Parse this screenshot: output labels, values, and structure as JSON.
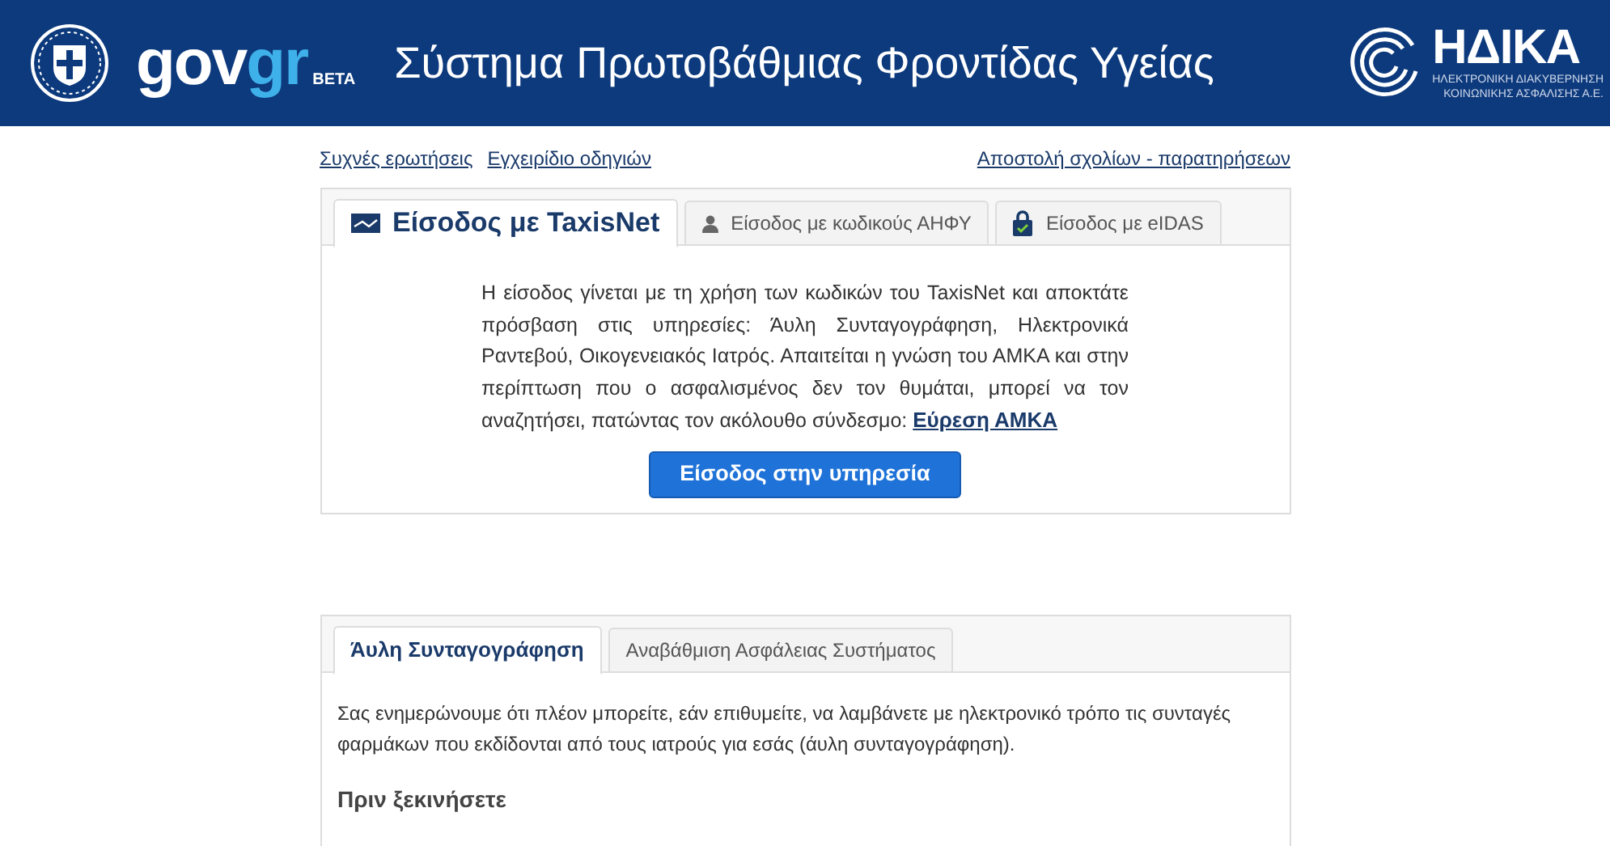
{
  "header": {
    "logo": {
      "part_1": "gov",
      "part_2": "gr",
      "badge": "BETA"
    },
    "title": "Σύστημα Πρωτοβάθμιας Φροντίδας Υγείας",
    "partner": {
      "name": "ΗΔΙΚΑ",
      "subtitle": [
        "ΗΛΕΚΤΡΟΝΙΚΗ ΔΙΑΚΥΒΕΡΝΗΣΗ",
        "ΚΟΙΝΩΝΙΚΗΣ ΑΣΦΑΛΙΣΗΣ Α.Ε."
      ]
    }
  },
  "links_left": [
    "Συχνές ερωτήσεις",
    "Εγχειρίδιο οδηγιών"
  ],
  "links_right": [
    "Αποστολή σχολίων - παρατηρήσεων"
  ],
  "login_panel": {
    "tabs": [
      {
        "label": "Είσοδος με TaxisNet",
        "kind": "card",
        "selected": true
      },
      {
        "label": "Είσοδος με κωδικούς ΑΗΦΥ",
        "kind": "user",
        "selected": false
      },
      {
        "label": "Είσοδος με eIDAS",
        "kind": "lock",
        "selected": false
      }
    ],
    "description": "Η είσοδος γίνεται με τη χρήση των κωδικών του TaxisNet και αποκτάτε πρόσβαση στις υπηρεσίες: Άυλη Συνταγογράφηση, Ηλεκτρονικά Ραντεβού, Οικογενειακός Ιατρός. Απαιτείται η γνώση του ΑΜΚΑ και στην περίπτωση που ο ασφαλισμένος δεν τον θυμάται, μπορεί να τον αναζητήσει, πατώντας τον ακόλουθο σύνδεσμο:",
    "link": "Εύρεση ΑΜΚΑ",
    "button": "Είσοδος στην υπηρεσία"
  },
  "info_panel": {
    "tabs": [
      {
        "label": "Άυλη Συνταγογράφηση",
        "selected": true
      },
      {
        "label": "Αναβάθμιση Ασφάλειας Συστήματος",
        "selected": false
      }
    ],
    "text": "Σας ενημερώνουμε ότι πλέον μπορείτε, εάν επιθυμείτε, να λαμβάνετε με ηλεκτρονικό τρόπο τις συνταγές φαρμάκων που εκδίδονται από τους ιατρούς για εσάς (άυλη συνταγογράφηση).",
    "heading": "Πριν ξεκινήσετε"
  }
}
